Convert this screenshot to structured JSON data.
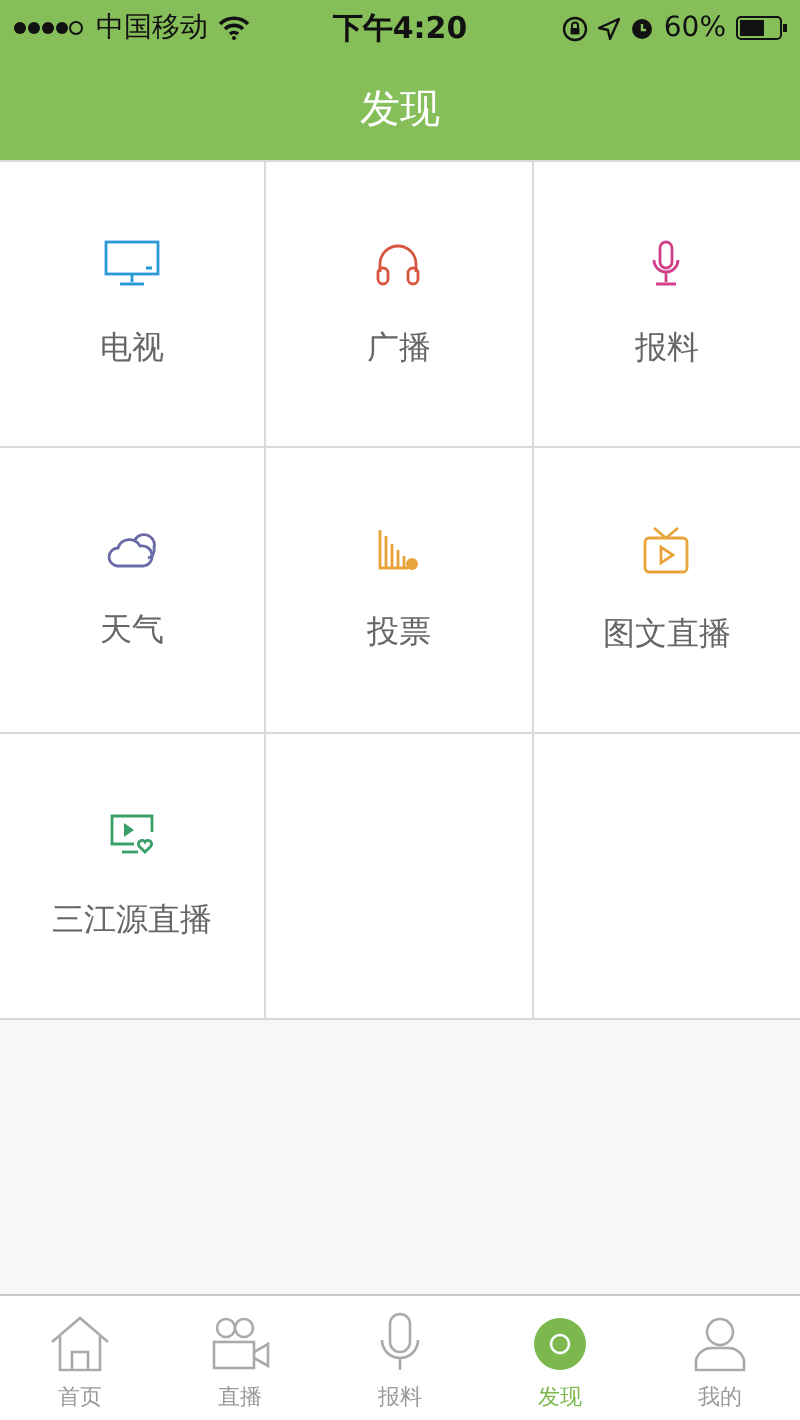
{
  "status_bar": {
    "carrier": "中国移动",
    "time": "下午4:20",
    "battery": "60%"
  },
  "nav_bar": {
    "title": "发现"
  },
  "grid": [
    {
      "label": "电视",
      "kind": "monitor",
      "color": "#2a9ad6"
    },
    {
      "label": "广播",
      "kind": "headphones",
      "color": "#d8553f"
    },
    {
      "label": "报料",
      "kind": "microphone",
      "color": "#d2408a"
    },
    {
      "label": "天气",
      "kind": "cloud",
      "color": "#6b6aa8"
    },
    {
      "label": "投票",
      "kind": "chart",
      "color": "#e8a43a"
    },
    {
      "label": "图文直播",
      "kind": "tv",
      "color": "#e8a43a"
    },
    {
      "label": "三江源直播",
      "kind": "screen",
      "color": "#3aa06a"
    }
  ],
  "tab_bar": [
    {
      "label": "首页",
      "kind": "home",
      "selected": false
    },
    {
      "label": "直播",
      "kind": "camera",
      "selected": false
    },
    {
      "label": "报料",
      "kind": "microphone",
      "selected": false
    },
    {
      "label": "发现",
      "kind": "discover",
      "selected": true
    },
    {
      "label": "我的",
      "kind": "person",
      "selected": false
    }
  ]
}
